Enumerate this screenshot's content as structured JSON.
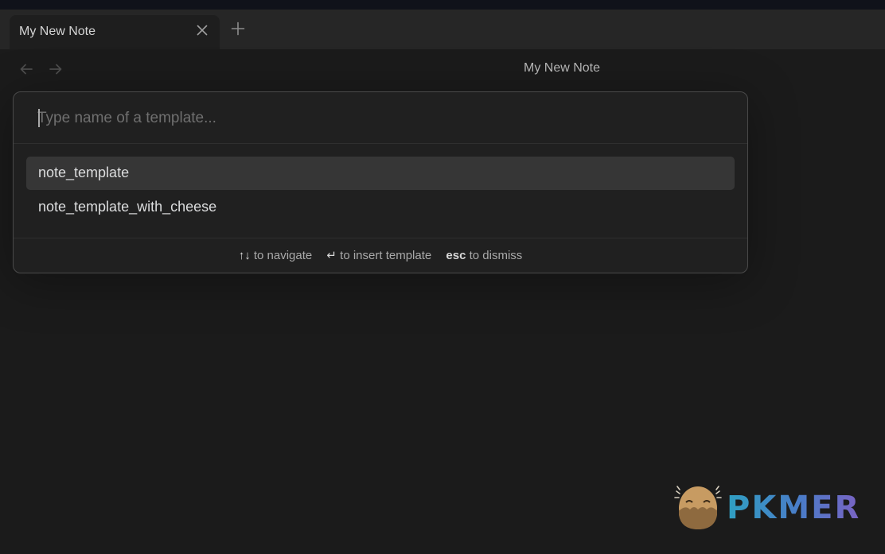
{
  "colors": {
    "background": "#1b1b1b",
    "tab_bar": "#262626",
    "modal_bg": "#202020",
    "selected_row": "#363636",
    "brand_gradient": [
      "#2f9fc2",
      "#4a7cc8",
      "#7a63c4"
    ]
  },
  "tabs": [
    {
      "label": "My New Note",
      "close_icon": "close-icon"
    }
  ],
  "tab_bar": {
    "new_tab_icon": "plus-icon"
  },
  "nav": {
    "back_icon": "arrow-left-icon",
    "forward_icon": "arrow-right-icon",
    "view_title": "My New Note"
  },
  "prompt": {
    "placeholder": "Type name of a template...",
    "value": "",
    "suggestions": [
      {
        "label": "note_template",
        "selected": true
      },
      {
        "label": "note_template_with_cheese",
        "selected": false
      }
    ],
    "instructions": [
      {
        "command": "↑↓",
        "purpose": "to navigate"
      },
      {
        "command": "↵",
        "purpose": "to insert template"
      },
      {
        "command": "esc",
        "purpose": "to dismiss"
      }
    ]
  },
  "watermark": {
    "text": "PKMER",
    "logo_icon": "egg-mascot-logo"
  }
}
